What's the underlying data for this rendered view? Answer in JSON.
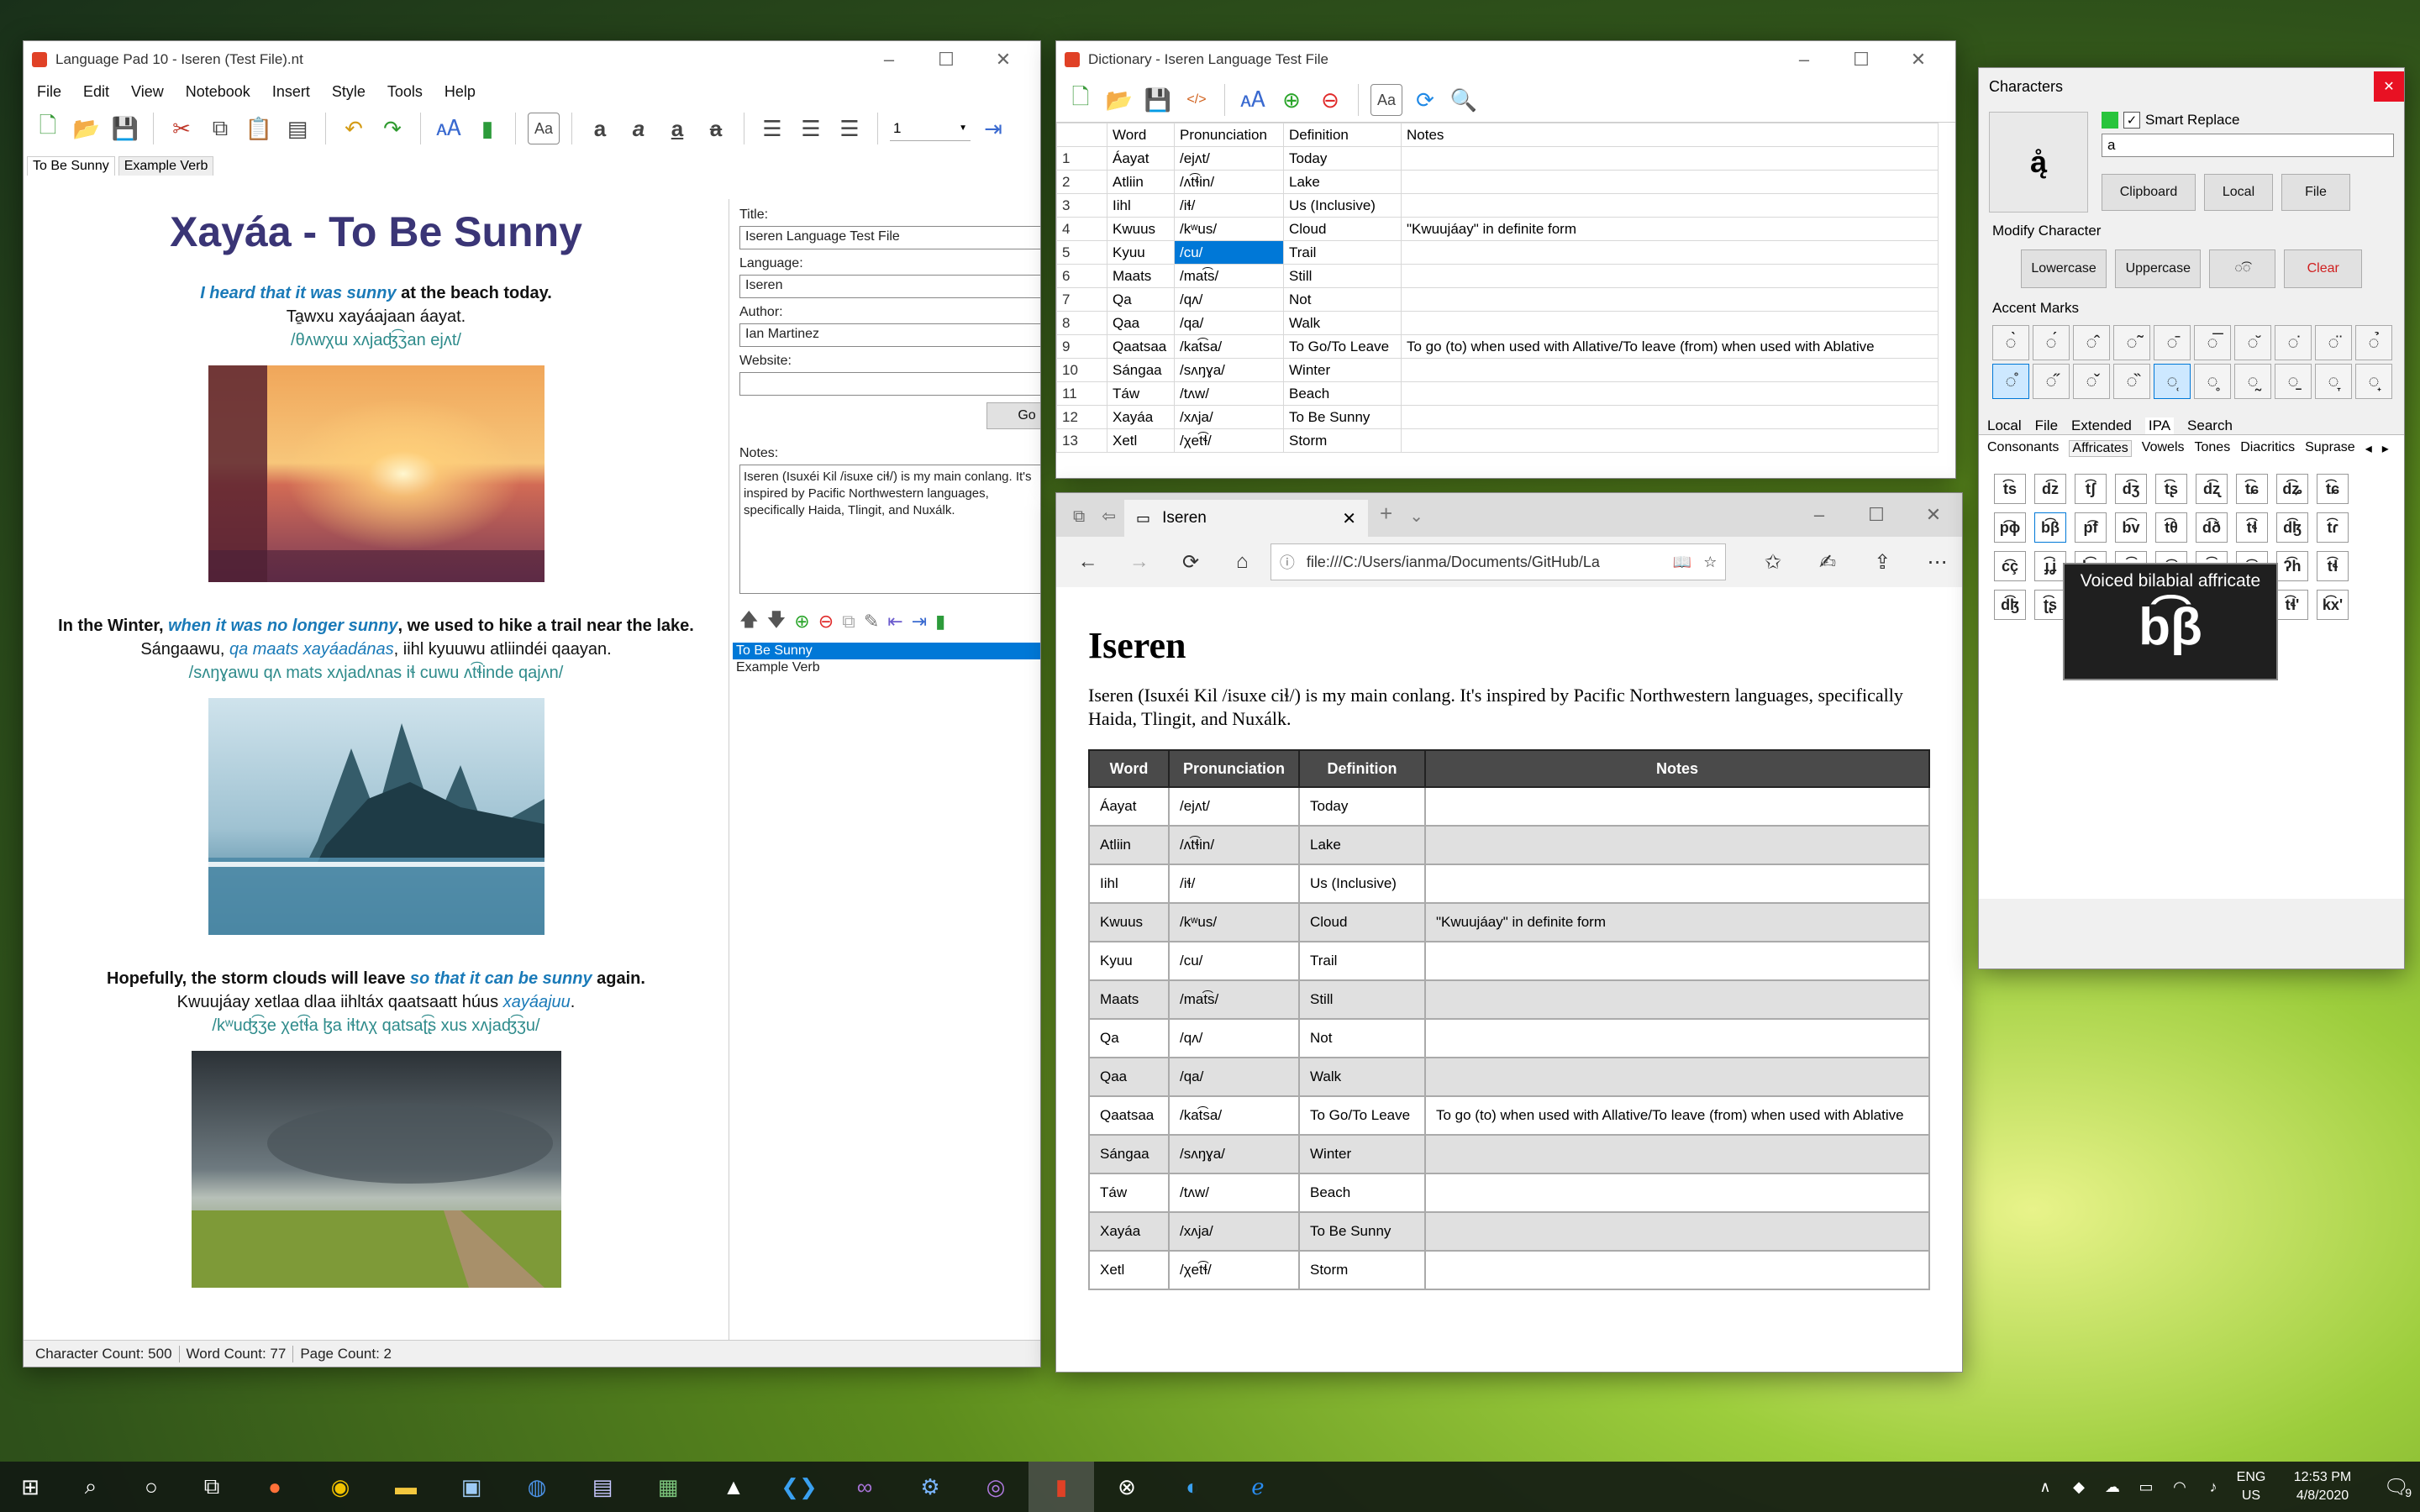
{
  "lp": {
    "title": "Language Pad 10 - Iseren (Test File).nt",
    "menus": [
      "File",
      "Edit",
      "View",
      "Notebook",
      "Insert",
      "Style",
      "Tools",
      "Help"
    ],
    "page_num": "1",
    "tabs": [
      "To Be Sunny",
      "Example Verb"
    ],
    "doc": {
      "heading": "Xayáa - To Be Sunny",
      "p1": {
        "em": "I heard that it was sunny",
        "plain": " at the beach today.",
        "line2": "Ta̱wxu xayáajaan áayat.",
        "line3": "/θʌwχɯ xʌjaʤ͡ʒan ejʌt/"
      },
      "p2": {
        "pre": "In the Winter, ",
        "em": "when it was no longer sunny",
        "plain": ", we used to hike a trail near the lake.",
        "line2a": "Sángaawu, ",
        "line2em": "qa maats xayáadánas",
        "line2b": ", iihl kyuuwu atliindéi qaayan.",
        "line3": "/sʌŋɣawu qʌ mats xʌjadʌnas iɬ cuwu ʌt͡ɬinde qajʌn/"
      },
      "p3": {
        "pre": "Hopefully, the storm clouds will leave ",
        "em": "so that it can be sunny",
        "plain": " again.",
        "line2a": "Kwuujáay xetlaa dlaa iihltáx qaatsaatt húus ",
        "line2em": "xayáajuu",
        "line2b": ".",
        "line3": "/kʷuʤ͡ʒe χet͡ɬa ɮa iɬtʌχ qatsaʈ͡ʂ xus xʌjaʤ͡ʒu/"
      }
    },
    "side": {
      "title_label": "Title:",
      "title": "Iseren Language Test File",
      "lang_label": "Language:",
      "lang": "Iseren",
      "author_label": "Author:",
      "author": "Ian Martinez",
      "web_label": "Website:",
      "web": "",
      "go": "Go",
      "notes_label": "Notes:",
      "notes": "Iseren (Isuxéi Kil /isuxe ciɬ/) is my main conlang. It's inspired by Pacific Northwestern languages, specifically Haida, Tlingit, and Nuxálk.",
      "pages": [
        "To Be Sunny",
        "Example Verb"
      ]
    },
    "status": {
      "chars": "Character Count: 500",
      "words": "Word Count: 77",
      "pages": "Page Count: 2"
    }
  },
  "dict": {
    "title": "Dictionary - Iseren Language Test File",
    "cols": [
      "Word",
      "Pronunciation",
      "Definition",
      "Notes"
    ],
    "rows": [
      [
        "1",
        "Áayat",
        "/ejʌt/",
        "Today",
        ""
      ],
      [
        "2",
        "Atliin",
        "/ʌt͡ɬin/",
        "Lake",
        ""
      ],
      [
        "3",
        "Iihl",
        "/iɬ/",
        "Us (Inclusive)",
        ""
      ],
      [
        "4",
        "Kwuus",
        "/kʷus/",
        "Cloud",
        "\"Kwuujáay\" in definite form"
      ],
      [
        "5",
        "Kyuu",
        "/cu/",
        "Trail",
        ""
      ],
      [
        "6",
        "Maats",
        "/mat͡s/",
        "Still",
        ""
      ],
      [
        "7",
        "Qa",
        "/qʌ/",
        "Not",
        ""
      ],
      [
        "8",
        "Qaa",
        "/qa/",
        "Walk",
        ""
      ],
      [
        "9",
        "Qaatsaa",
        "/kat͡sa/",
        "To Go/To Leave",
        "To go (to) when used with Allative/To leave (from) when used with Ablative"
      ],
      [
        "10",
        "Sángaa",
        "/sʌŋɣa/",
        "Winter",
        ""
      ],
      [
        "11",
        "Táw",
        "/tʌw/",
        "Beach",
        ""
      ],
      [
        "12",
        "Xayáa",
        "/xʌja/",
        "To Be Sunny",
        ""
      ],
      [
        "13",
        "Xetl",
        "/χet͡ɬ/",
        "Storm",
        ""
      ]
    ]
  },
  "browser": {
    "tab": "Iseren",
    "url": "file:///C:/Users/ianma/Documents/GitHub/La",
    "heading": "Iseren",
    "intro": "Iseren (Isuxéi Kil /isuxe ciɬ/) is my main conlang. It's inspired by Pacific Northwestern languages, specifically Haida, Tlingit, and Nuxálk.",
    "cols": [
      "Word",
      "Pronunciation",
      "Definition",
      "Notes"
    ],
    "rows": [
      [
        "Áayat",
        "/ejʌt/",
        "Today",
        ""
      ],
      [
        "Atliin",
        "/ʌt͡ɬin/",
        "Lake",
        ""
      ],
      [
        "Iihl",
        "/iɬ/",
        "Us (Inclusive)",
        ""
      ],
      [
        "Kwuus",
        "/kʷus/",
        "Cloud",
        "\"Kwuujáay\" in definite form"
      ],
      [
        "Kyuu",
        "/cu/",
        "Trail",
        ""
      ],
      [
        "Maats",
        "/mat͡s/",
        "Still",
        ""
      ],
      [
        "Qa",
        "/qʌ/",
        "Not",
        ""
      ],
      [
        "Qaa",
        "/qa/",
        "Walk",
        ""
      ],
      [
        "Qaatsaa",
        "/kat͡sa/",
        "To Go/To Leave",
        "To go (to) when used with Allative/To leave (from) when used with Ablative"
      ],
      [
        "Sángaa",
        "/sʌŋɣa/",
        "Winter",
        ""
      ],
      [
        "Táw",
        "/tʌw/",
        "Beach",
        ""
      ],
      [
        "Xayáa",
        "/xʌja/",
        "To Be Sunny",
        ""
      ],
      [
        "Xetl",
        "/χet͡ɬ/",
        "Storm",
        ""
      ]
    ]
  },
  "chars": {
    "title": "Characters",
    "preview": "ą̊",
    "smart": "Smart Replace",
    "input": "a",
    "buttons": [
      "Clipboard",
      "Local",
      "File"
    ],
    "modify_label": "Modify Character",
    "modify": [
      "Lowercase",
      "Uppercase",
      "◌͡◌",
      "Clear"
    ],
    "accent_label": "Accent Marks",
    "accents": [
      "◌̀",
      "◌́",
      "◌̂",
      "◌̃",
      "◌̄",
      "◌̅",
      "◌̆",
      "◌̇",
      "◌̈",
      "◌̉",
      "◌̊",
      "◌̋",
      "◌̌",
      "◌̏",
      "◌̜",
      "◌̥",
      "◌̰",
      "◌̠",
      "◌̞",
      "◌̟"
    ],
    "tabs1": [
      "Local",
      "File",
      "Extended",
      "IPA",
      "Search"
    ],
    "tabs2": [
      "Consonants",
      "Affricates",
      "Vowels",
      "Tones",
      "Diacritics",
      "Suprase"
    ],
    "affricates": [
      "t͡s",
      "d͡z",
      "t͡ʃ",
      "d͡ʒ",
      "t͡ʂ",
      "d͡ʐ",
      "t͡ɕ",
      "d͡ʑ",
      "t͡ɕ",
      "p͡ɸ",
      "b͡β",
      "p͡f",
      "b͡v",
      "t͡θ",
      "d͡ð",
      "t͡ɬ",
      "d͡ɮ",
      "t͡ɾ",
      "c͡ç",
      "ɟ͡ʝ",
      "k͡x",
      "ɡ͡ɣ",
      "q͡χ",
      "ɢ͡ʁ",
      "x͡ʀ",
      "ʔ͡h",
      "t͡ɬ",
      "d͡ɮ",
      "ʈ͡ʂ",
      "ɖ͡ʐ",
      "t͡s'",
      "t͡ʃ'",
      "t͡s'",
      "t͡ɕ'",
      "t͡ɬ'",
      "k͡x'"
    ],
    "tooltip_label": "Voiced bilabial affricate",
    "tooltip_glyph": "b͡β"
  },
  "taskbar": {
    "lang": "ENG",
    "region": "US",
    "time": "12:53 PM",
    "date": "4/8/2020",
    "notif": "9"
  }
}
